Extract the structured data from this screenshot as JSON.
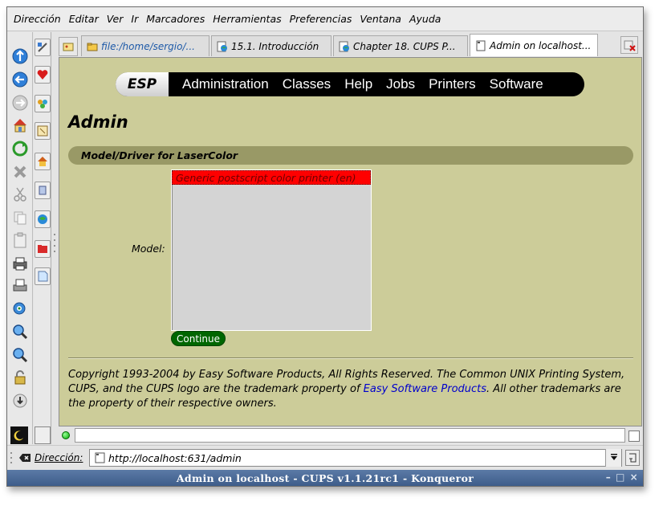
{
  "menubar": {
    "items": [
      "Dirección",
      "Editar",
      "Ver",
      "Ir",
      "Marcadores",
      "Herramientas",
      "Preferencias",
      "Ventana",
      "Ayuda"
    ],
    "accelerators": [
      "D",
      "E",
      "V",
      "I",
      "M",
      "H",
      "P",
      "V",
      "A"
    ]
  },
  "vtoolbar": {
    "icons": [
      "forward-icon",
      "back-icon",
      "stop-gray-icon",
      "home-icon",
      "reload-icon",
      "stop-icon",
      "cut-icon",
      "copy-icon",
      "paste-icon",
      "print-icon",
      "print-frame-icon",
      "zoom-icon",
      "zoom-in-icon",
      "zoom-out-icon",
      "security-icon",
      "download-icon"
    ]
  },
  "sidebar": {
    "icons": [
      "bookmarks-heart-icon",
      "services-icon",
      "history-icon",
      "home-folder-icon",
      "devices-icon",
      "network-icon",
      "root-folder-icon",
      "notes-icon"
    ]
  },
  "tabs": [
    {
      "label": "file:/home/sergio/...",
      "icon": "folder-icon",
      "color": "#1e5aa8"
    },
    {
      "label": "15.1. Introducción",
      "icon": "web-icon",
      "color": "#000000"
    },
    {
      "label": "Chapter 18. CUPS P...",
      "icon": "web-icon",
      "color": "#000000"
    },
    {
      "label": "Admin on localhost...",
      "icon": "page-icon",
      "color": "#000000"
    }
  ],
  "content": {
    "nav": {
      "brand": "ESP",
      "links": [
        "Administration",
        "Classes",
        "Help",
        "Jobs",
        "Printers",
        "Software"
      ]
    },
    "title": "Admin",
    "section": "Model/Driver for LaserColor",
    "model_label": "Model:",
    "model_options": [
      "Generic postscript color printer (en)"
    ],
    "continue_label": "Continue",
    "copyright_pre": "Copyright 1993-2004 by Easy Software Products, All Rights Reserved. The Common UNIX Printing System, CUPS, and the CUPS logo are the trademark property of ",
    "copyright_link": "Easy Software Products",
    "copyright_post": ". All other trademarks are the property of their respective owners."
  },
  "location": {
    "label": "Dirección:",
    "url": "http://localhost:631/admin"
  },
  "window": {
    "title": "Admin on localhost - CUPS v1.1.21rc1 - Konqueror",
    "controls": [
      "–",
      "□",
      "×"
    ]
  },
  "colors": {
    "page_bg": "#cccc99",
    "section_bar": "#999966",
    "selected_option": "#ff0000",
    "continue_button": "#006600",
    "link": "#0000cc",
    "titlebar": "#4a6a96"
  }
}
